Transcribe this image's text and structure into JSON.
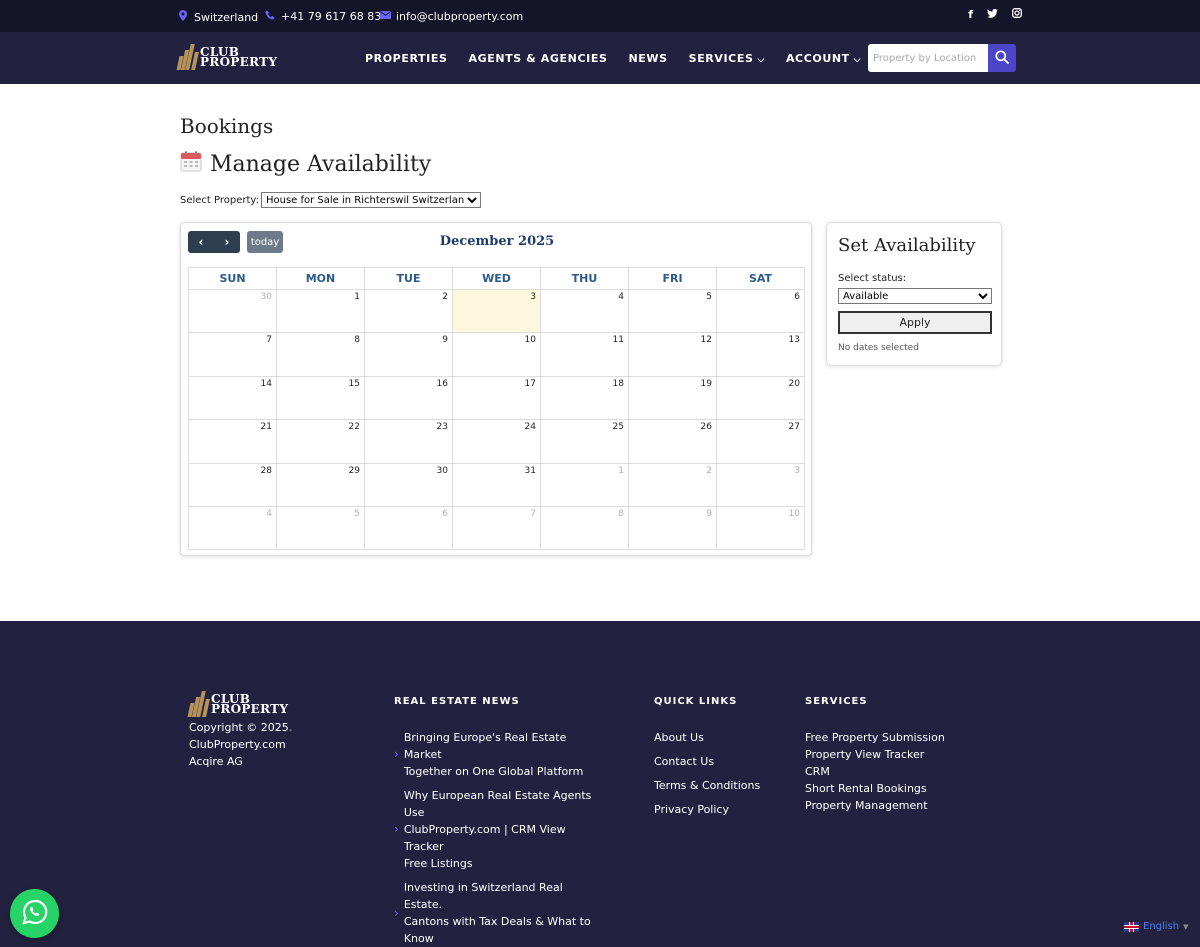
{
  "topbar": {
    "location": "Switzerland",
    "phone": "+41 79 617 68 83",
    "email": "info@clubproperty.com",
    "social": [
      "facebook-icon",
      "twitter-icon",
      "instagram-icon"
    ]
  },
  "brand": {
    "line1": "CLUB",
    "line2": "PROPERTY",
    "gold": "#b6925b"
  },
  "nav": {
    "items": [
      {
        "label": "PROPERTIES",
        "dropdown": false
      },
      {
        "label": "AGENTS & AGENCIES",
        "dropdown": false
      },
      {
        "label": "NEWS",
        "dropdown": false
      },
      {
        "label": "SERVICES",
        "dropdown": true
      },
      {
        "label": "ACCOUNT",
        "dropdown": true
      }
    ],
    "search_placeholder": "Property by Location",
    "accent": "#4b45c8"
  },
  "page": {
    "title": "Bookings",
    "subtitle": "Manage Availability",
    "select_label": "Select Property:",
    "selected_property": "House for Sale in Richterswil Switzerland"
  },
  "calendar": {
    "prev_icon": "chevron-left-icon",
    "next_icon": "chevron-right-icon",
    "today_label": "today",
    "month_title": "December 2025",
    "weekdays": [
      "SUN",
      "MON",
      "TUE",
      "WED",
      "THU",
      "FRI",
      "SAT"
    ],
    "weeks": [
      [
        {
          "d": "30",
          "o": true
        },
        {
          "d": "1"
        },
        {
          "d": "2"
        },
        {
          "d": "3",
          "t": true
        },
        {
          "d": "4"
        },
        {
          "d": "5"
        },
        {
          "d": "6"
        }
      ],
      [
        {
          "d": "7"
        },
        {
          "d": "8"
        },
        {
          "d": "9"
        },
        {
          "d": "10"
        },
        {
          "d": "11"
        },
        {
          "d": "12"
        },
        {
          "d": "13"
        }
      ],
      [
        {
          "d": "14"
        },
        {
          "d": "15"
        },
        {
          "d": "16"
        },
        {
          "d": "17"
        },
        {
          "d": "18"
        },
        {
          "d": "19"
        },
        {
          "d": "20"
        }
      ],
      [
        {
          "d": "21"
        },
        {
          "d": "22"
        },
        {
          "d": "23"
        },
        {
          "d": "24"
        },
        {
          "d": "25"
        },
        {
          "d": "26"
        },
        {
          "d": "27"
        }
      ],
      [
        {
          "d": "28"
        },
        {
          "d": "29"
        },
        {
          "d": "30"
        },
        {
          "d": "31"
        },
        {
          "d": "1",
          "o": true
        },
        {
          "d": "2",
          "o": true
        },
        {
          "d": "3",
          "o": true
        }
      ],
      [
        {
          "d": "4",
          "o": true
        },
        {
          "d": "5",
          "o": true
        },
        {
          "d": "6",
          "o": true
        },
        {
          "d": "7",
          "o": true
        },
        {
          "d": "8",
          "o": true
        },
        {
          "d": "9",
          "o": true
        },
        {
          "d": "10",
          "o": true
        }
      ]
    ]
  },
  "availability": {
    "title": "Set Availability",
    "status_label": "Select status:",
    "status_value": "Available",
    "apply_label": "Apply",
    "note": "No dates selected"
  },
  "footer": {
    "brand_line1": "CLUB",
    "brand_line2": "PROPERTY",
    "copyright": "Copyright © 2025.",
    "site": "ClubProperty.com",
    "company": "Acqire AG",
    "news_heading": "REAL ESTATE NEWS",
    "news": [
      [
        "Bringing Europe's Real Estate Market",
        "Together on One Global Platform"
      ],
      [
        "Why European Real Estate Agents Use",
        "ClubProperty.com | CRM View Tracker",
        "Free Listings"
      ],
      [
        "Investing in Switzerland Real Estate.",
        "Cantons with Tax Deals & What to",
        "Know"
      ]
    ],
    "quick_heading": "QUICK LINKS",
    "quick_links": [
      "About Us",
      "Contact Us",
      "Terms & Conditions",
      "Privacy Policy"
    ],
    "services_heading": "SERVICES",
    "services": [
      "Free Property Submission",
      "Property View Tracker",
      "CRM",
      "Short Rental Bookings",
      "Property Management"
    ]
  },
  "language": {
    "label": "English",
    "flag": "uk-flag-icon"
  },
  "whatsapp": {
    "icon": "whatsapp-icon",
    "color": "#25d366"
  }
}
